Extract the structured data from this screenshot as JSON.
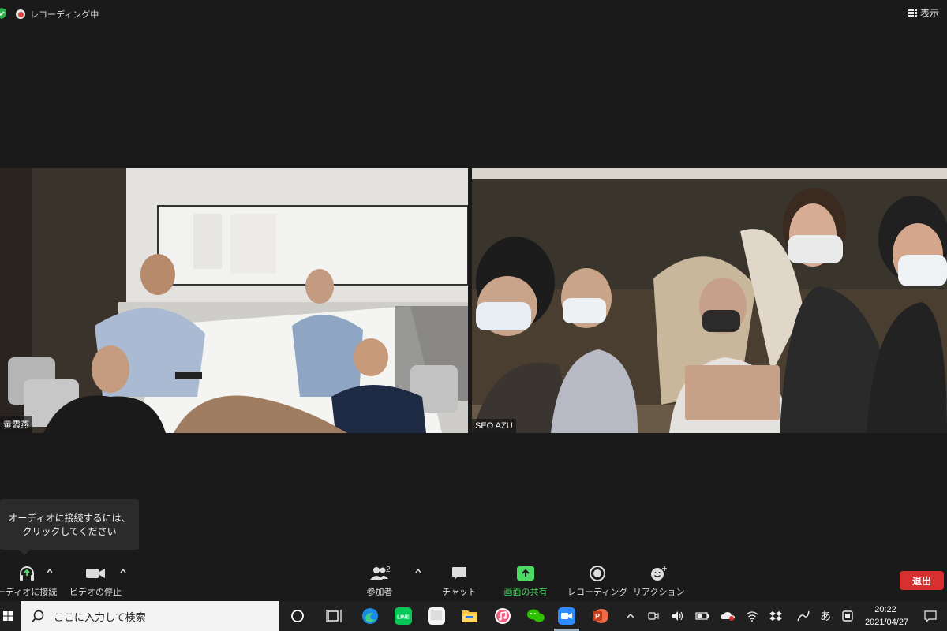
{
  "status_bar": {
    "recording_label": "レコーディング中",
    "view_label": "表示"
  },
  "participants": [
    {
      "name": "黄霞燕"
    },
    {
      "name": "SEO AZU"
    }
  ],
  "tooltip": {
    "line1": "オーディオに接続するには、",
    "line2": "クリックしてください"
  },
  "toolbar": {
    "audio_label": "ーディオに接続",
    "video_label": "ビデオの停止",
    "participants_label": "参加者",
    "participants_count": "2",
    "chat_label": "チャット",
    "share_label": "画面の共有",
    "record_label": "レコーディング",
    "reaction_label": "リアクション",
    "leave_label": "退出",
    "share_color": "#4cd964",
    "leave_color": "#d8302e"
  },
  "taskbar": {
    "search_placeholder": "ここに入力して検索",
    "ime_label": "あ",
    "time": "20:22",
    "date": "2021/04/27",
    "apps": [
      "cortana-icon",
      "task-view-icon",
      "edge-icon",
      "line-icon",
      "app-icon",
      "file-explorer-icon",
      "itunes-icon",
      "wechat-icon",
      "zoom-icon",
      "powerpoint-icon"
    ]
  }
}
